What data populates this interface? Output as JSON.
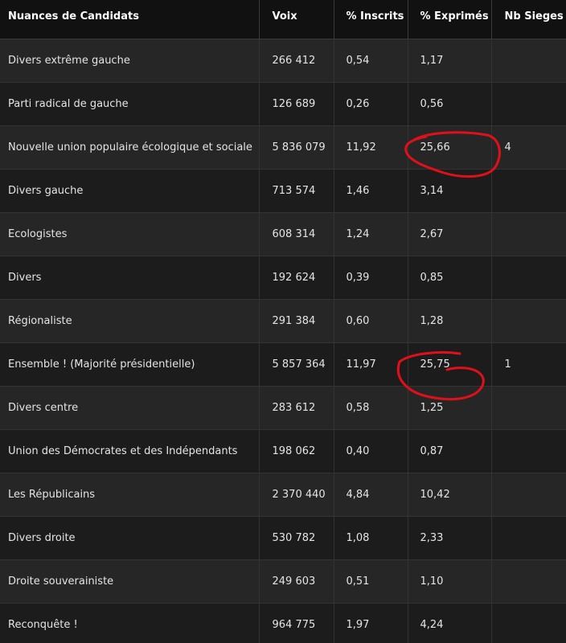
{
  "table": {
    "headers": [
      "Nuances de Candidats",
      "Voix",
      "% Inscrits",
      "% Exprimés",
      "Nb Sieges"
    ],
    "rows": [
      [
        "Divers extrême gauche",
        "266 412",
        "0,54",
        "1,17",
        ""
      ],
      [
        "Parti radical de gauche",
        "126 689",
        "0,26",
        "0,56",
        ""
      ],
      [
        "Nouvelle union populaire écologique et sociale",
        "5 836 079",
        "11,92",
        "25,66",
        "4"
      ],
      [
        "Divers gauche",
        "713 574",
        "1,46",
        "3,14",
        ""
      ],
      [
        "Ecologistes",
        "608 314",
        "1,24",
        "2,67",
        ""
      ],
      [
        "Divers",
        "192 624",
        "0,39",
        "0,85",
        ""
      ],
      [
        "Régionaliste",
        "291 384",
        "0,60",
        "1,28",
        ""
      ],
      [
        "Ensemble ! (Majorité présidentielle)",
        "5 857 364",
        "11,97",
        "25,75",
        "1"
      ],
      [
        "Divers centre",
        "283 612",
        "0,58",
        "1,25",
        ""
      ],
      [
        "Union des Démocrates et des Indépendants",
        "198 062",
        "0,40",
        "0,87",
        ""
      ],
      [
        "Les Républicains",
        "2 370 440",
        "4,84",
        "10,42",
        ""
      ],
      [
        "Divers droite",
        "530 782",
        "1,08",
        "2,33",
        ""
      ],
      [
        "Droite souverainiste",
        "249 603",
        "0,51",
        "1,10",
        ""
      ],
      [
        "Reconquête !",
        "964 775",
        "1,97",
        "4,24",
        ""
      ]
    ]
  },
  "colors": {
    "annotation": "#e0101a",
    "header_bg": "#111111",
    "row_odd": "#262626",
    "row_even": "#1c1c1c"
  }
}
